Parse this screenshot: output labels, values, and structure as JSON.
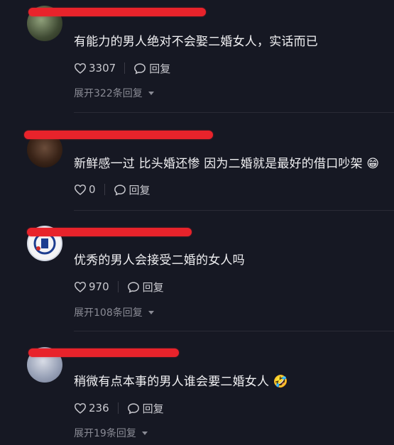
{
  "comments": [
    {
      "text": "有能力的男人绝对不会娶二婚女人，实话而已",
      "likes": "3307",
      "reply_label": "回复",
      "expand": "展开322条回复"
    },
    {
      "text": "新鲜感一过 比头婚还惨 因为二婚就是最好的借口吵架 😁",
      "likes": "0",
      "reply_label": "回复",
      "expand": ""
    },
    {
      "text": "优秀的男人会接受二婚的女人吗",
      "likes": "970",
      "reply_label": "回复",
      "expand": "展开108条回复"
    },
    {
      "text": "稍微有点本事的男人谁会要二婚女人 🤣",
      "likes": "236",
      "reply_label": "回复",
      "expand": "展开19条回复"
    }
  ],
  "icons": {
    "like": "heart-outline-icon",
    "reply": "speech-bubble-icon",
    "expand": "caret-down-icon"
  },
  "colors": {
    "background": "#161823",
    "redaction": "#e8232b",
    "muted_text": "#8a8b95"
  }
}
